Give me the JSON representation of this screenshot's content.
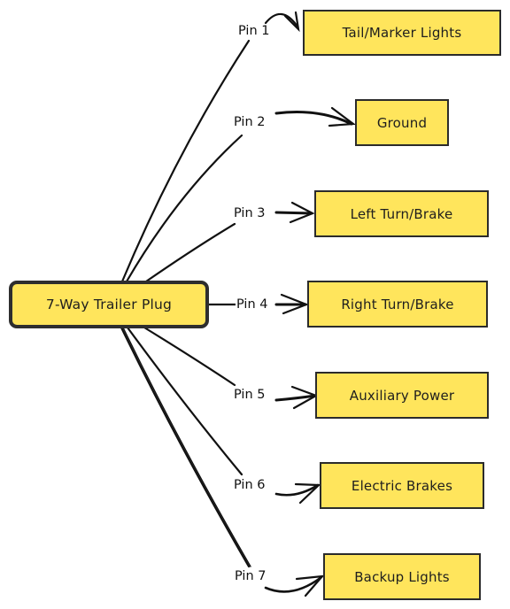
{
  "diagram": {
    "title": "7-Way Trailer Plug",
    "colors": {
      "node_fill": "#ffe55c",
      "stroke": "#1e1e1e",
      "background": "#ffffff"
    },
    "root": {
      "label": "7-Way Trailer Plug"
    },
    "pins": [
      {
        "pin": "Pin 1",
        "function": "Tail/Marker Lights"
      },
      {
        "pin": "Pin 2",
        "function": "Ground"
      },
      {
        "pin": "Pin 3",
        "function": "Left Turn/Brake"
      },
      {
        "pin": "Pin 4",
        "function": "Right Turn/Brake"
      },
      {
        "pin": "Pin 5",
        "function": "Auxiliary Power"
      },
      {
        "pin": "Pin 6",
        "function": "Electric Brakes"
      },
      {
        "pin": "Pin 7",
        "function": "Backup Lights"
      }
    ]
  }
}
